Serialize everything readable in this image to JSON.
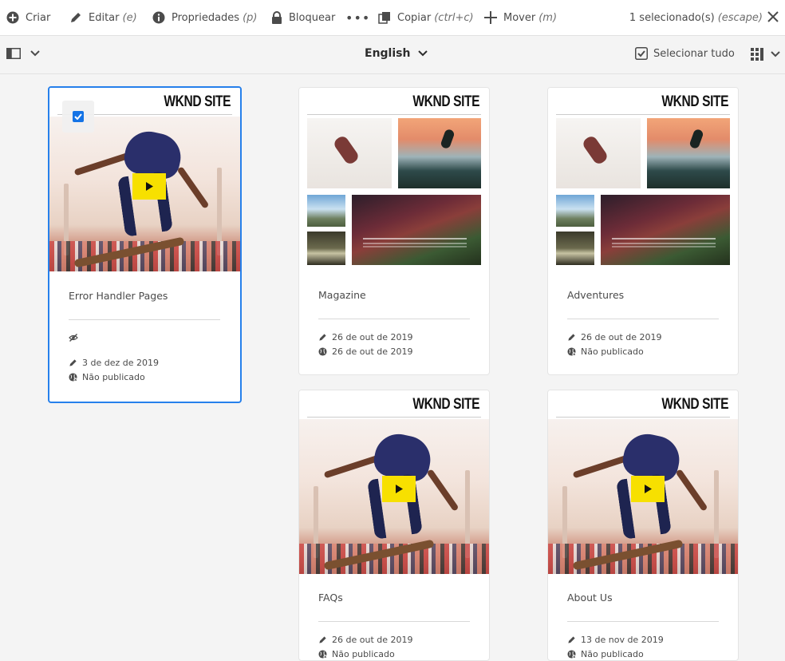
{
  "actions": {
    "create": "Criar",
    "edit": "Editar",
    "edit_shortcut": "(e)",
    "properties": "Propriedades",
    "properties_shortcut": "(p)",
    "lock": "Bloquear",
    "more": "•••",
    "copy": "Copiar",
    "copy_shortcut": "(ctrl+c)",
    "move": "Mover",
    "move_shortcut": "(m)",
    "selection_count": "1 selecionado(s)",
    "selection_escape": "(escape)"
  },
  "subbar": {
    "title": "English",
    "select_all": "Selecionar tudo"
  },
  "site_label": "WKND SITE",
  "cards": [
    {
      "title": "Error Handler Pages",
      "hidden_icon": "eye-slash-icon",
      "modified": "3 de dez de 2019",
      "published": "Não publicado",
      "selected": true,
      "thumb": "skater"
    },
    {
      "title": "Magazine",
      "modified": "26 de out de 2019",
      "published": "26 de out de 2019",
      "selected": false,
      "thumb": "collage"
    },
    {
      "title": "Adventures",
      "modified": "26 de out de 2019",
      "published": "Não publicado",
      "selected": false,
      "thumb": "collage"
    },
    {
      "title": "FAQs",
      "modified": "26 de out de 2019",
      "published": "Não publicado",
      "selected": false,
      "thumb": "skater"
    },
    {
      "title": "About Us",
      "modified": "13 de nov de 2019",
      "published": "Não publicado",
      "selected": false,
      "thumb": "skater"
    }
  ],
  "colors": {
    "accent": "#2680eb",
    "play": "#f7e000"
  }
}
